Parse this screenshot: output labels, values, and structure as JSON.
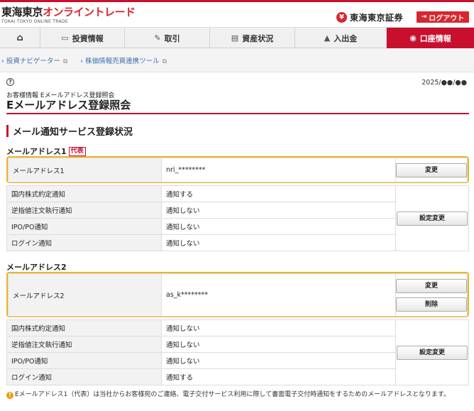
{
  "header": {
    "logo_text_1": "東海東京",
    "logo_text_2": "オンライントレード",
    "logo_sub": "TOKAI TOKYO ONLINE TRADE",
    "brand_mark": "¥",
    "brand_name": "東海東京証券",
    "logout_label": "ログアウト"
  },
  "gnav": {
    "items": [
      {
        "label": "",
        "icon": "home-icon"
      },
      {
        "label": "投資情報",
        "icon": "monitor-icon"
      },
      {
        "label": "取引",
        "icon": "trade-icon"
      },
      {
        "label": "資産状況",
        "icon": "asset-icon"
      },
      {
        "label": "入出金",
        "icon": "deposit-icon"
      },
      {
        "label": "口座情報",
        "icon": "account-icon"
      }
    ],
    "active_index": 5
  },
  "subnav": {
    "links": [
      "投資ナビゲーター",
      "株価情報売買連携ツール"
    ]
  },
  "page": {
    "date": "2025/●●/●●",
    "breadcrumb": "お客様情報 Eメールアドレス登録照会",
    "title": "Eメールアドレス登録照会",
    "section_title": "メール通知サービス登録状況"
  },
  "address1": {
    "heading": "メールアドレス1",
    "badge": "代表",
    "label": "メールアドレス1",
    "value": "nri_********",
    "change_button": "変更",
    "settings_button": "設定変更",
    "notifications": [
      {
        "label": "国内株式約定通知",
        "value": "通知する"
      },
      {
        "label": "逆指値注文執行通知",
        "value": "通知しない"
      },
      {
        "label": "IPO/PO通知",
        "value": "通知しない"
      },
      {
        "label": "ログイン通知",
        "value": "通知しない"
      }
    ]
  },
  "address2": {
    "heading": "メールアドレス2",
    "label": "メールアドレス2",
    "value": "as_k********",
    "change_button": "変更",
    "delete_button": "削除",
    "settings_button": "設定変更",
    "notifications": [
      {
        "label": "国内株式約定通知",
        "value": "通知しない"
      },
      {
        "label": "逆指値注文執行通知",
        "value": "通知しない"
      },
      {
        "label": "IPO/PO通知",
        "value": "通知しない"
      },
      {
        "label": "ログイン通知",
        "value": "通知する"
      }
    ]
  },
  "note": "Eメールアドレス1（代表）は当社からお客様宛のご連絡、電子交付サービス利用に際して書面電子交付時通知をするためのメールアドレスとなります。",
  "colors": {
    "brand_red": "#c8102e",
    "highlight_border": "#f0b323",
    "link_blue": "#3a6fb0"
  }
}
